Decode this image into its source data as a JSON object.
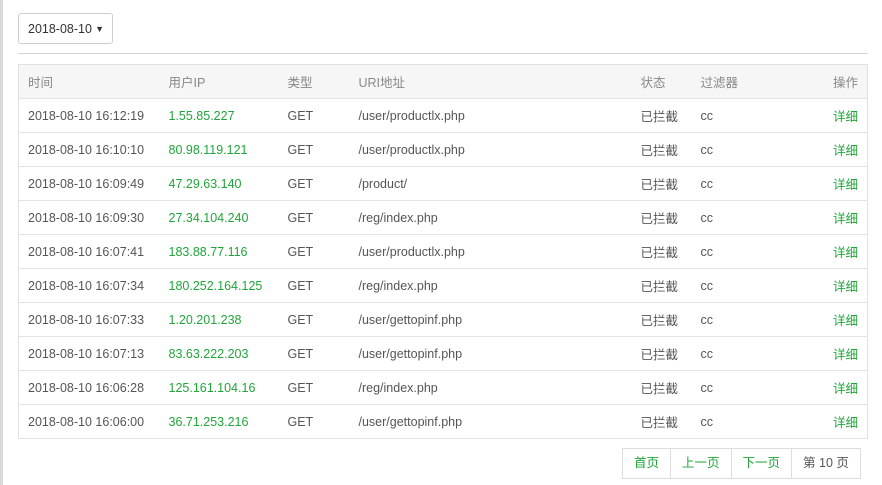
{
  "filter": {
    "date_value": "2018-08-10",
    "caret": "▼"
  },
  "table": {
    "columns": {
      "time": "时间",
      "ip": "用户IP",
      "type": "类型",
      "uri": "URI地址",
      "status": "状态",
      "filter": "过滤器",
      "action": "操作"
    },
    "rows": [
      {
        "time": "2018-08-10 16:12:19",
        "ip": "1.55.85.227",
        "type": "GET",
        "uri": "/user/productlx.php",
        "status": "已拦截",
        "filter": "cc",
        "action": "详细"
      },
      {
        "time": "2018-08-10 16:10:10",
        "ip": "80.98.119.121",
        "type": "GET",
        "uri": "/user/productlx.php",
        "status": "已拦截",
        "filter": "cc",
        "action": "详细"
      },
      {
        "time": "2018-08-10 16:09:49",
        "ip": "47.29.63.140",
        "type": "GET",
        "uri": "/product/",
        "status": "已拦截",
        "filter": "cc",
        "action": "详细"
      },
      {
        "time": "2018-08-10 16:09:30",
        "ip": "27.34.104.240",
        "type": "GET",
        "uri": "/reg/index.php",
        "status": "已拦截",
        "filter": "cc",
        "action": "详细"
      },
      {
        "time": "2018-08-10 16:07:41",
        "ip": "183.88.77.116",
        "type": "GET",
        "uri": "/user/productlx.php",
        "status": "已拦截",
        "filter": "cc",
        "action": "详细"
      },
      {
        "time": "2018-08-10 16:07:34",
        "ip": "180.252.164.125",
        "type": "GET",
        "uri": "/reg/index.php",
        "status": "已拦截",
        "filter": "cc",
        "action": "详细"
      },
      {
        "time": "2018-08-10 16:07:33",
        "ip": "1.20.201.238",
        "type": "GET",
        "uri": "/user/gettopinf.php",
        "status": "已拦截",
        "filter": "cc",
        "action": "详细"
      },
      {
        "time": "2018-08-10 16:07:13",
        "ip": "83.63.222.203",
        "type": "GET",
        "uri": "/user/gettopinf.php",
        "status": "已拦截",
        "filter": "cc",
        "action": "详细"
      },
      {
        "time": "2018-08-10 16:06:28",
        "ip": "125.161.104.16",
        "type": "GET",
        "uri": "/reg/index.php",
        "status": "已拦截",
        "filter": "cc",
        "action": "详细"
      },
      {
        "time": "2018-08-10 16:06:00",
        "ip": "36.71.253.216",
        "type": "GET",
        "uri": "/user/gettopinf.php",
        "status": "已拦截",
        "filter": "cc",
        "action": "详细"
      }
    ]
  },
  "pagination": {
    "first": "首页",
    "prev": "上一页",
    "next": "下一页",
    "current": "第 10 页"
  },
  "colors": {
    "accent": "#20a53a",
    "header_bg": "#f6f6f6",
    "border": "#e3e3e3"
  }
}
